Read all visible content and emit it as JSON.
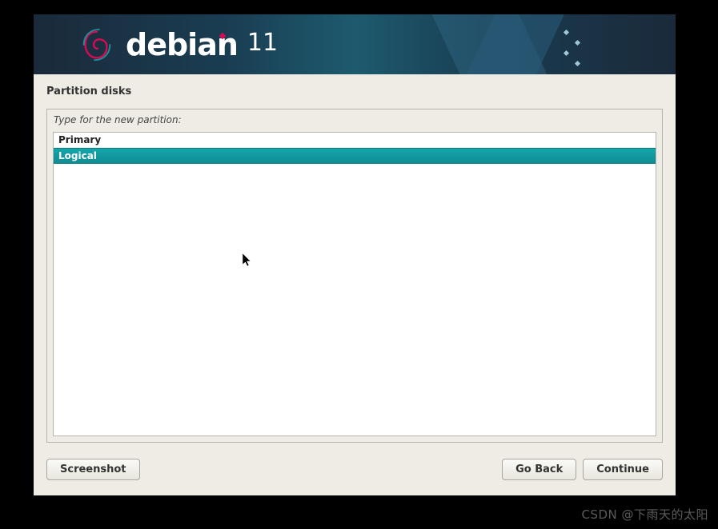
{
  "header": {
    "brand": "debian",
    "version": "11"
  },
  "page": {
    "title": "Partition disks",
    "prompt": "Type for the new partition:"
  },
  "options": [
    {
      "label": "Primary",
      "selected": false
    },
    {
      "label": "Logical",
      "selected": true
    }
  ],
  "buttons": {
    "screenshot": "Screenshot",
    "go_back": "Go Back",
    "continue": "Continue"
  },
  "watermark": "CSDN @下雨天的太阳"
}
